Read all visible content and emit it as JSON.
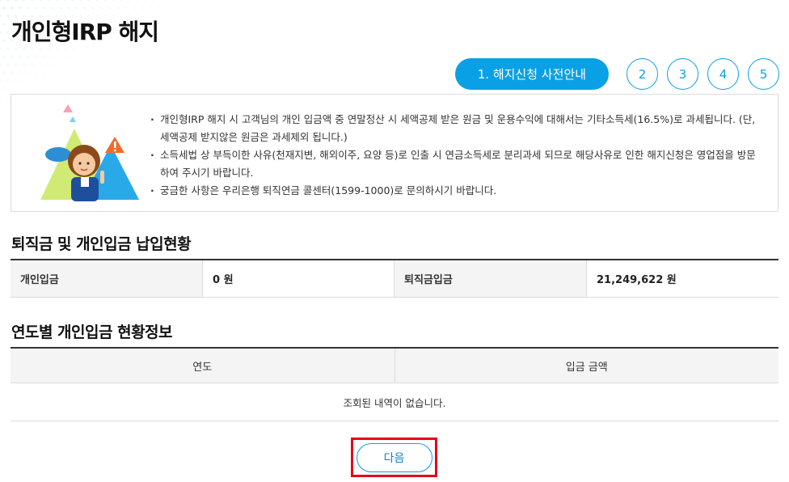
{
  "page": {
    "title": "개인형IRP 해지"
  },
  "steps": {
    "active_label": "1. 해지신청 사전안내",
    "others": [
      "2",
      "3",
      "4",
      "5"
    ]
  },
  "notice": {
    "items": [
      "개인형IRP 해지 시 고객님의 개인 입금액 중 연말정산 시 세액공제 받은 원금 및 운용수익에 대해서는 기타소득세(16.5%)로 과세됩니다. (단, 세액공제 받지않은 원금은 과세제외 됩니다.)",
      "소득세법 상 부득이한 사유(천재지변, 해외이주, 요양 등)로 인출 시 연금소득세로 분리과세 되므로 해당사유로 인한 해지신청은 영업점을 방문하여 주시기 바랍니다.",
      "궁금한 사항은 우리은행 퇴직연금 콜센터(1599-1000)로 문의하시기 바랍니다."
    ]
  },
  "summary": {
    "title": "퇴직금 및 개인입금 납입현황",
    "personal_label": "개인입금",
    "personal_value": "0 원",
    "retirement_label": "퇴직금입금",
    "retirement_value": "21,249,622 원"
  },
  "yearly": {
    "title": "연도별 개인입금 현황정보",
    "col_year": "연도",
    "col_amount": "입금 금액",
    "empty_message": "조회된 내역이 없습니다."
  },
  "actions": {
    "next_label": "다음"
  },
  "colors": {
    "accent": "#0aa0e6",
    "highlight": "#e5001c"
  }
}
